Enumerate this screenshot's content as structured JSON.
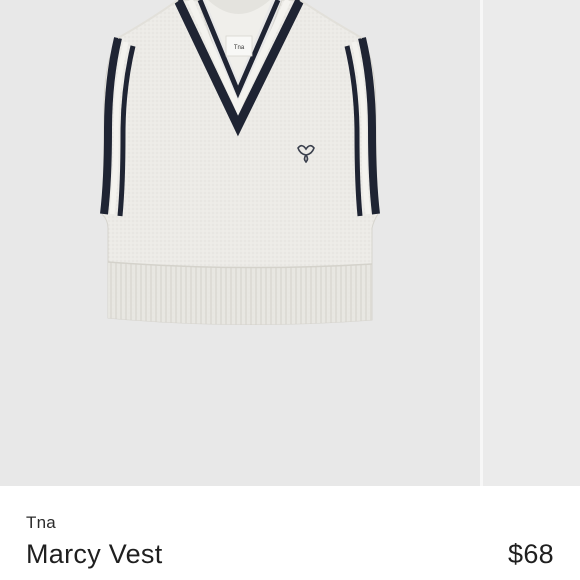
{
  "product": {
    "brand": "Tna",
    "name": "Marcy Vest",
    "price": "$68",
    "label_text": "Tna",
    "image_icon": "knit-vest-photo"
  },
  "colors": {
    "background": "#e8e8e8",
    "vest_body": "#ecebe7",
    "trim_navy": "#1f2433",
    "text": "#1f1f1f"
  },
  "gallery": {
    "slides_visible": 2
  }
}
